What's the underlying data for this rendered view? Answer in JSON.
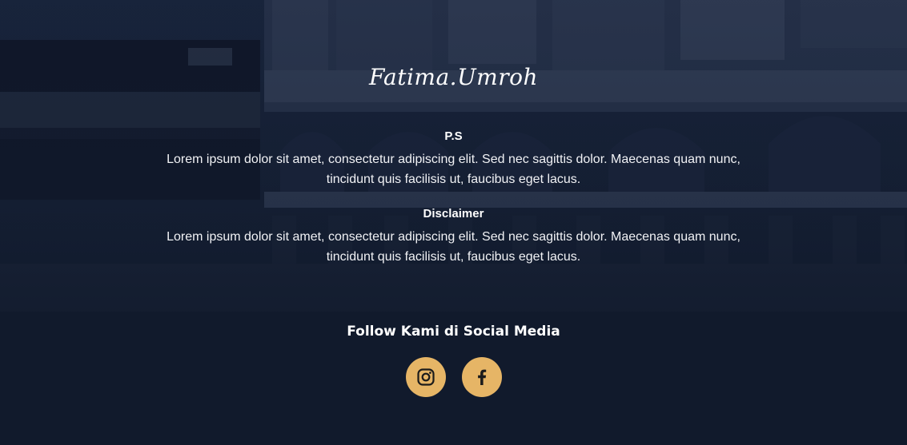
{
  "footer": {
    "brand": "Fatima.Umroh",
    "ps": {
      "heading": "P.S",
      "line1": "Lorem ipsum dolor sit amet, consectetur adipiscing elit. Sed nec sagittis dolor. Maecenas quam nunc,",
      "line2": "tincidunt quis facilisis ut, faucibus eget lacus."
    },
    "disclaimer": {
      "heading": "Disclaimer",
      "line1": "Lorem ipsum dolor sit amet, consectetur adipiscing elit. Sed nec sagittis dolor. Maecenas quam nunc,",
      "line2": "tincidunt quis facilisis ut, faucibus eget lacus."
    },
    "social": {
      "title": "Follow Kami di Social Media",
      "icons": [
        "instagram-icon",
        "facebook-icon"
      ]
    }
  },
  "colors": {
    "background": "#111a2c",
    "accent": "#e6b566",
    "icon": "#1b1b1b",
    "text": "#ffffff"
  }
}
